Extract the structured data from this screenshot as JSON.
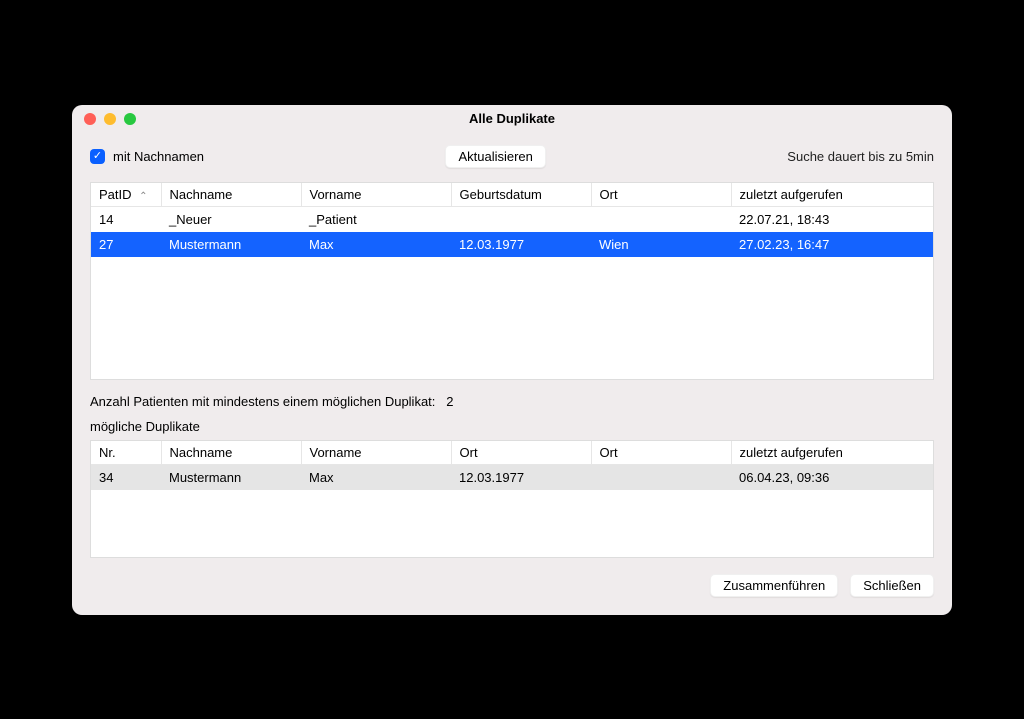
{
  "window": {
    "title": "Alle Duplikate"
  },
  "toolbar": {
    "checkbox_label": "mit Nachnamen",
    "refresh_label": "Aktualisieren",
    "hint": "Suche dauert bis zu 5min"
  },
  "patients": {
    "columns": {
      "id": "PatID",
      "nachname": "Nachname",
      "vorname": "Vorname",
      "geb": "Geburtsdatum",
      "ort": "Ort",
      "zuletzt": "zuletzt aufgerufen"
    },
    "rows": [
      {
        "id": "14",
        "nachname": "_Neuer",
        "vorname": "_Patient",
        "geb": "",
        "ort": "",
        "zuletzt": "22.07.21, 18:43"
      },
      {
        "id": "27",
        "nachname": "Mustermann",
        "vorname": "Max",
        "geb": "12.03.1977",
        "ort": "Wien",
        "zuletzt": "27.02.23, 16:47"
      }
    ]
  },
  "count_line": {
    "label": "Anzahl Patienten mit mindestens einem möglichen Duplikat:",
    "value": "2"
  },
  "duplicates": {
    "heading": "mögliche Duplikate",
    "columns": {
      "nr": "Nr.",
      "nachname": "Nachname",
      "vorname": "Vorname",
      "ort1": "Ort",
      "ort2": "Ort",
      "zuletzt": "zuletzt aufgerufen"
    },
    "rows": [
      {
        "nr": "34",
        "nachname": "Mustermann",
        "vorname": "Max",
        "ort1": "12.03.1977",
        "ort2": "",
        "zuletzt": "06.04.23, 09:36"
      }
    ]
  },
  "footer": {
    "merge": "Zusammenführen",
    "close": "Schließen"
  }
}
